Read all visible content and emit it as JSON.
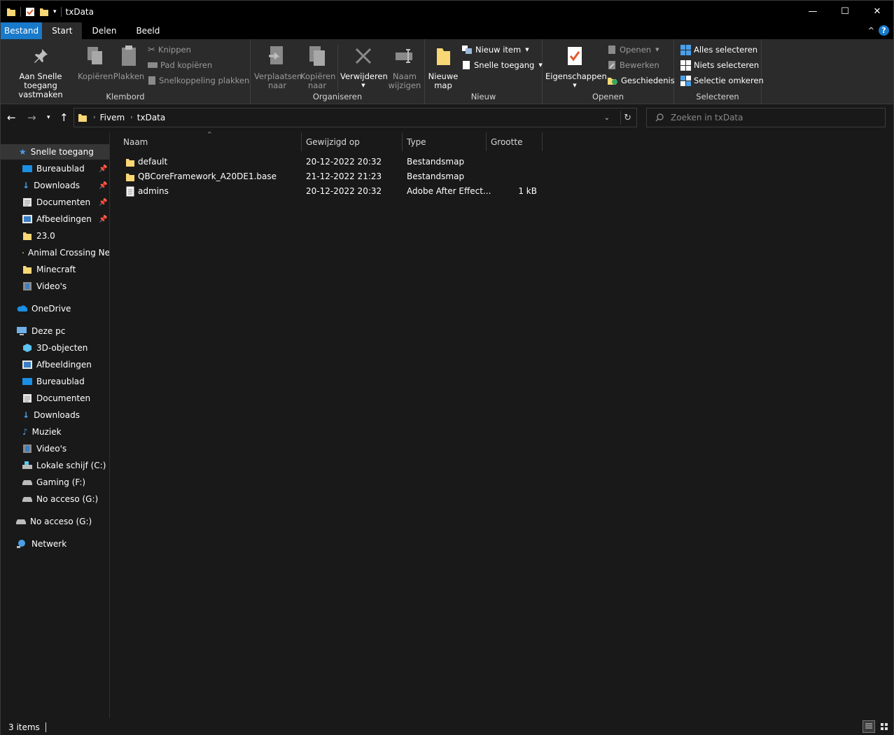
{
  "window": {
    "title": "txData",
    "minimize": "—",
    "maximize": "☐",
    "close": "✕"
  },
  "tabs": {
    "file": "Bestand",
    "home": "Start",
    "share": "Delen",
    "view": "Beeld",
    "collapse": "^",
    "help": "?"
  },
  "ribbon": {
    "clipboard": {
      "group": "Klembord",
      "pin_l1": "Aan Snelle toegang",
      "pin_l2": "vastmaken",
      "copy": "Kopiëren",
      "paste": "Plakken",
      "cut": "Knippen",
      "copy_path": "Pad kopiëren",
      "paste_shortcut": "Snelkoppeling plakken"
    },
    "organize": {
      "group": "Organiseren",
      "move_l1": "Verplaatsen",
      "move_l2": "naar",
      "copyto_l1": "Kopiëren",
      "copyto_l2": "naar",
      "delete": "Verwijderen",
      "rename_l1": "Naam",
      "rename_l2": "wijzigen"
    },
    "new": {
      "group": "Nieuw",
      "folder_l1": "Nieuwe",
      "folder_l2": "map",
      "new_item": "Nieuw item",
      "easy_access": "Snelle toegang"
    },
    "open": {
      "group": "Openen",
      "properties": "Eigenschappen",
      "open": "Openen",
      "edit": "Bewerken",
      "history": "Geschiedenis"
    },
    "select": {
      "group": "Selecteren",
      "all": "Alles selecteren",
      "none": "Niets selecteren",
      "invert": "Selectie omkeren"
    }
  },
  "address": {
    "crumbs": [
      "Fivem",
      "txData"
    ],
    "search_placeholder": "Zoeken in txData"
  },
  "sidebar": {
    "quick": "Snelle toegang",
    "quick_items": [
      "Bureaublad",
      "Downloads",
      "Documenten",
      "Afbeeldingen",
      "23.0",
      "Animal Crossing Ne",
      "Minecraft",
      "Video's"
    ],
    "onedrive": "OneDrive",
    "thispc": "Deze pc",
    "pc_items": [
      "3D-objecten",
      "Afbeeldingen",
      "Bureaublad",
      "Documenten",
      "Downloads",
      "Muziek",
      "Video's",
      "Lokale schijf (C:)",
      "Gaming (F:)",
      "No acceso (G:)"
    ],
    "drive": "No acceso (G:)",
    "network": "Netwerk"
  },
  "columns": {
    "name": "Naam",
    "modified": "Gewijzigd op",
    "type": "Type",
    "size": "Grootte"
  },
  "files": [
    {
      "name": "default",
      "modified": "20-12-2022 20:32",
      "type": "Bestandsmap",
      "size": ""
    },
    {
      "name": "QBCoreFramework_A20DE1.base",
      "modified": "21-12-2022 21:23",
      "type": "Bestandsmap",
      "size": ""
    },
    {
      "name": "admins",
      "modified": "20-12-2022 20:32",
      "type": "Adobe After Effect...",
      "size": "1 kB"
    }
  ],
  "status": {
    "count": "3 items"
  },
  "colors": {
    "accent": "#1979ca",
    "folder": "#f8d775",
    "background": "#191919",
    "ribbon": "#2b2b2b"
  }
}
